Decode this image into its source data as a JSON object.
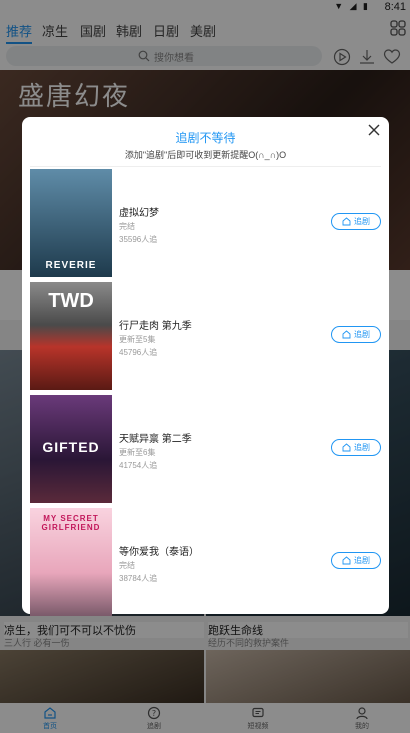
{
  "status_bar": {
    "time": "8:41"
  },
  "top_tabs": [
    {
      "label": "推荐",
      "active": true
    },
    {
      "label": "凉生",
      "active": false
    },
    {
      "label": "国剧",
      "active": false
    },
    {
      "label": "韩剧",
      "active": false
    },
    {
      "label": "日剧",
      "active": false
    },
    {
      "label": "美剧",
      "active": false
    }
  ],
  "search": {
    "placeholder": "搜你想看"
  },
  "background": {
    "banner_title": "盛唐幻夜",
    "tiles": [
      {
        "title": "凉生，我们可不可以不忧伤",
        "subtitle": "三人行 必有一伤"
      },
      {
        "title": "跑跃生命线",
        "subtitle": "经历不同的救护案件"
      }
    ]
  },
  "modal": {
    "title": "追剧不等待",
    "subtitle": "添加\"追剧\"后即可收到更新提醒O(∩_∩)O",
    "follow_label": "追剧",
    "items": [
      {
        "title": "虚拟幻梦",
        "status": "完结",
        "followers": "35596人追",
        "poster_text": "REVERIE",
        "poster_color": "#3a6f8c"
      },
      {
        "title": "行尸走肉 第九季",
        "status": "更新至5集",
        "followers": "45796人追",
        "poster_text": "TWD",
        "poster_color": "#b8342a"
      },
      {
        "title": "天赋异禀 第二季",
        "status": "更新至6集",
        "followers": "41754人追",
        "poster_text": "GIFTED",
        "poster_color": "#4a2a5a"
      },
      {
        "title": "等你爱我（泰语）",
        "status": "完结",
        "followers": "38784人追",
        "poster_text": "MY SECRET GIRLFRIEND",
        "poster_color": "#f3b8c8"
      }
    ]
  },
  "bottom_nav": [
    {
      "label": "首页",
      "active": true
    },
    {
      "label": "追剧",
      "active": false
    },
    {
      "label": "短视频",
      "active": false
    },
    {
      "label": "我的",
      "active": false
    }
  ],
  "colors": {
    "accent": "#2196f3"
  }
}
